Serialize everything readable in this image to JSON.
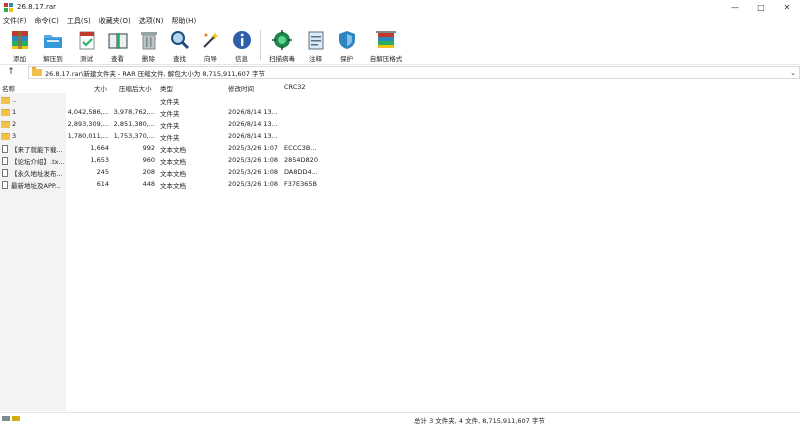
{
  "window": {
    "title": "26.8.17.rar",
    "controls": [
      "minimize-icon",
      "maximize-icon",
      "close-icon"
    ]
  },
  "menu": [
    "文件(F)",
    "命令(C)",
    "工具(S)",
    "收藏夹(O)",
    "选项(N)",
    "帮助(H)"
  ],
  "toolbar": [
    {
      "label": "添加",
      "icon": "add-archive-icon"
    },
    {
      "label": "解压到",
      "icon": "extract-to-icon"
    },
    {
      "label": "测试",
      "icon": "test-icon"
    },
    {
      "label": "查看",
      "icon": "view-book-icon"
    },
    {
      "label": "删除",
      "icon": "trash-icon"
    },
    {
      "label": "查找",
      "icon": "magnifier-icon"
    },
    {
      "label": "向导",
      "icon": "wizard-wand-icon"
    },
    {
      "label": "信息",
      "icon": "info-icon"
    },
    {
      "label": "扫描病毒",
      "icon": "virus-scan-icon"
    },
    {
      "label": "注释",
      "icon": "comment-icon"
    },
    {
      "label": "保护",
      "icon": "shield-icon"
    },
    {
      "label": "自解压格式",
      "icon": "sfx-icon"
    }
  ],
  "address": {
    "up": "↑",
    "path": "26.8.17.rar\\新建文件夹 - RAR 压缩文件, 解包大小为 8,715,911,607 字节"
  },
  "columns": {
    "name": "名称",
    "size": "大小",
    "packed": "压缩后大小",
    "type": "类型",
    "mtime": "修改时间",
    "crc": "CRC32"
  },
  "files": [
    {
      "icon": "folder",
      "name": "..",
      "size": "",
      "packed": "",
      "type": "文件夹",
      "mtime": "",
      "crc": ""
    },
    {
      "icon": "folder",
      "name": "1",
      "size": "4,042,586,...",
      "packed": "3,978,762,...",
      "type": "文件夹",
      "mtime": "2026/8/14 13...",
      "crc": ""
    },
    {
      "icon": "folder",
      "name": "2",
      "size": "2,893,309,...",
      "packed": "2,851,380,...",
      "type": "文件夹",
      "mtime": "2026/8/14 13...",
      "crc": ""
    },
    {
      "icon": "folder",
      "name": "3",
      "size": "1,780,011,...",
      "packed": "1,753,370,...",
      "type": "文件夹",
      "mtime": "2026/8/14 13...",
      "crc": ""
    },
    {
      "icon": "txt",
      "name": "【来了就能下载...",
      "size": "1,664",
      "packed": "992",
      "type": "文本文档",
      "mtime": "2025/3/26 1:07",
      "crc": "ECCC3B..."
    },
    {
      "icon": "txt",
      "name": "【论坛介绍】.tx...",
      "size": "1,653",
      "packed": "960",
      "type": "文本文档",
      "mtime": "2025/3/26 1:08",
      "crc": "2854D820"
    },
    {
      "icon": "txt",
      "name": "【永久地址发布...",
      "size": "245",
      "packed": "208",
      "type": "文本文档",
      "mtime": "2025/3/26 1:08",
      "crc": "DA8DD4..."
    },
    {
      "icon": "txt",
      "name": "最新地址及APP...",
      "size": "614",
      "packed": "448",
      "type": "文本文档",
      "mtime": "2025/3/26 1:08",
      "crc": "F37E365B"
    }
  ],
  "status": {
    "text": "总计 3 文件夹, 4 文件, 8,715,911,607 字节"
  }
}
